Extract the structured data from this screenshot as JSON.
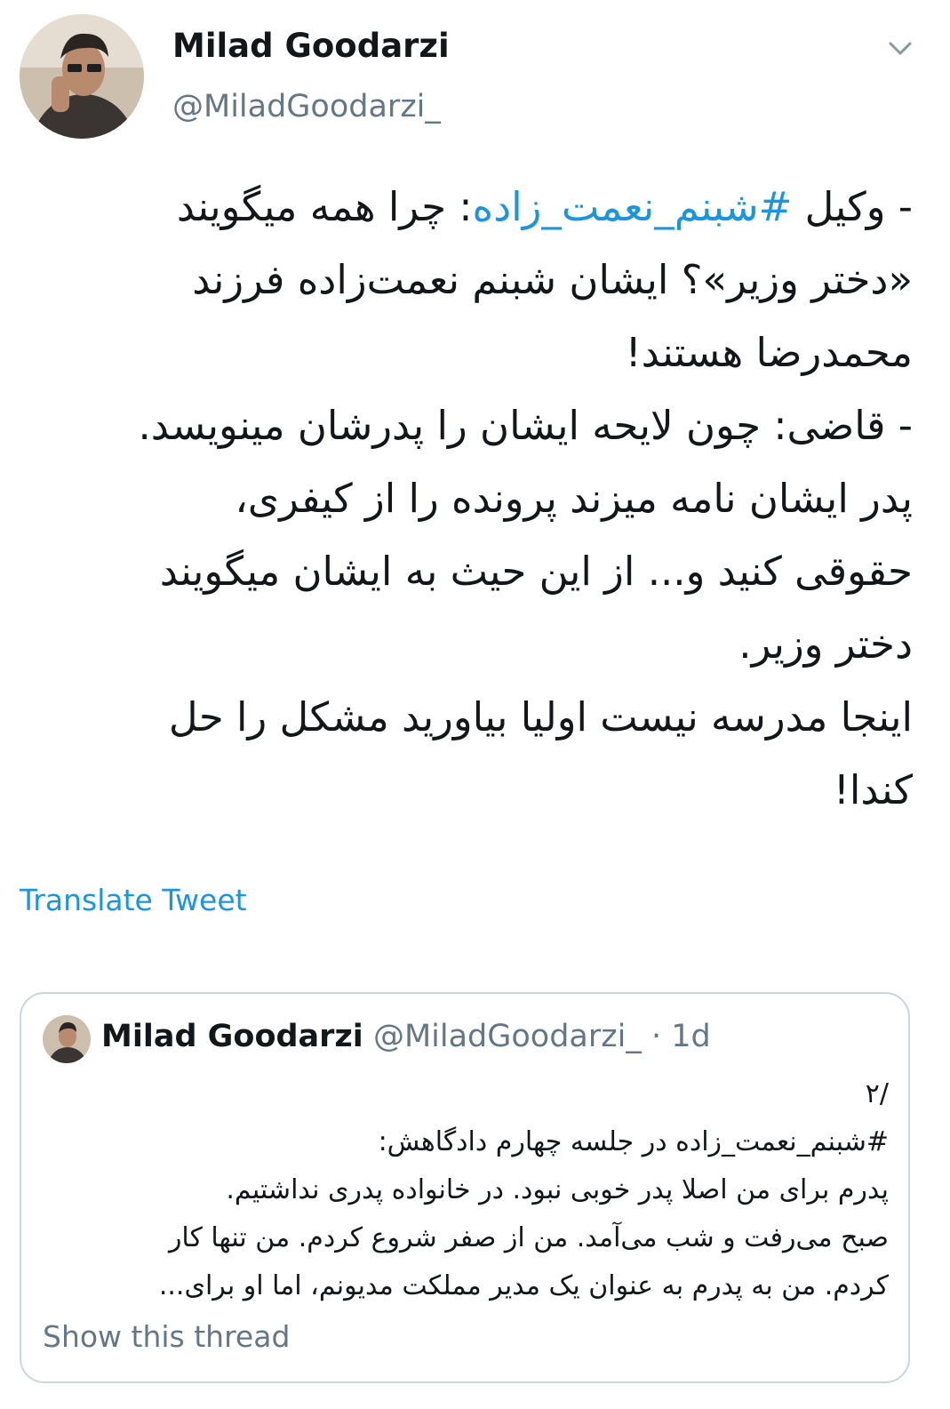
{
  "author": {
    "display_name": "Milad Goodarzi",
    "handle": "@MiladGoodarzi_"
  },
  "icons": {
    "caret": "chevron-down-icon"
  },
  "tweet": {
    "lines": [
      "- وکیل ",
      "#شبنم_نعمت_زاده",
      ": چرا همه میگویند",
      "«دختر وزیر»؟ ایشان شبنم نعمت‌زاده فرزند",
      "محمدرضا هستند!",
      "- قاضی: چون لایحه ایشان را پدرشان مینویسد.",
      "پدر ایشان نامه میزند پرونده را از کیفری،",
      "حقوقی کنید و... از این حیث به ایشان میگویند",
      "دختر وزیر.",
      "اینجا مدرسه نیست اولیا بیاورید مشکل را حل",
      "کندا!"
    ],
    "translate_label": "Translate Tweet"
  },
  "quoted_tweet": {
    "display_name": "Milad Goodarzi",
    "handle_and_time": "@MiladGoodarzi_ · 1d",
    "lines": [
      "/۲",
      "#شبنم_نعمت_زاده در جلسه چهارم دادگاهش:",
      "پدرم برای من اصلا پدر خوبی نبود. در خانواده پدری نداشتیم.",
      "صبح می‌رفت و شب می‌آمد. من از صفر شروع کردم. من تنها کار",
      "کردم. من به پدرم به عنوان یک مدیر مملکت مدیونم، اما او برای..."
    ],
    "show_thread_label": "Show this thread"
  },
  "colors": {
    "link": "#1b95e0",
    "secondary_text": "#657786",
    "border": "#ccd6dd"
  }
}
